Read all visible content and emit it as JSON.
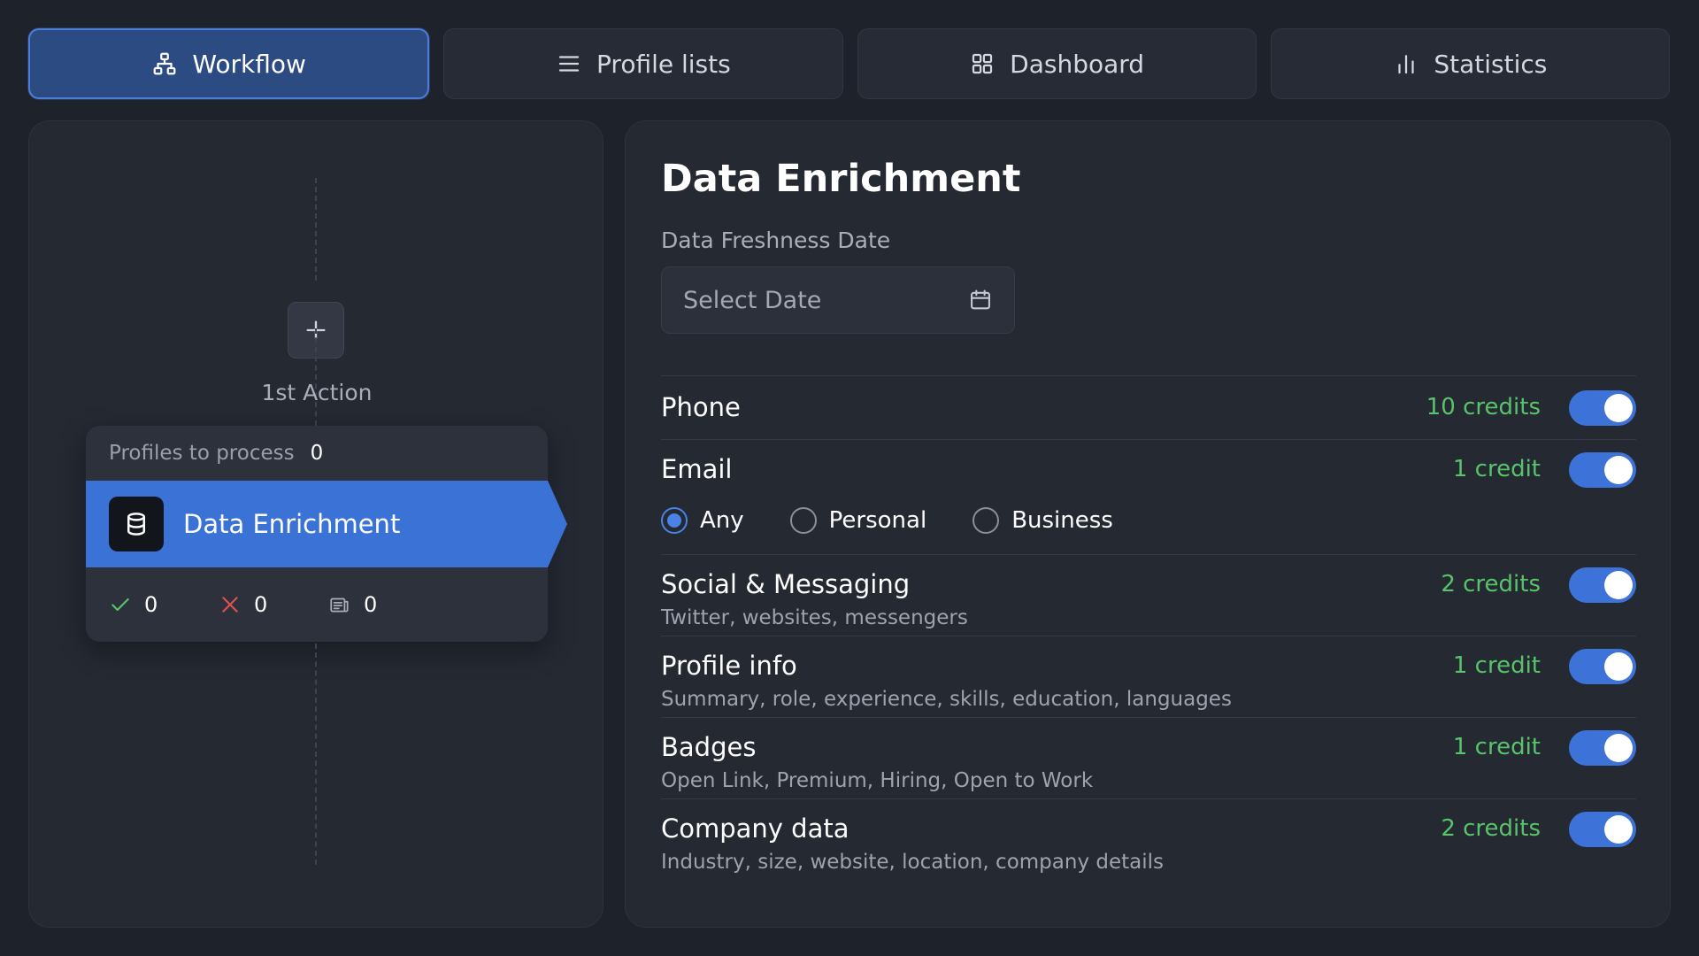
{
  "tabs": [
    {
      "label": "Workflow",
      "icon": "workflow-icon",
      "active": true
    },
    {
      "label": "Profile lists",
      "icon": "list-icon",
      "active": false
    },
    {
      "label": "Dashboard",
      "icon": "grid-icon",
      "active": false
    },
    {
      "label": "Statistics",
      "icon": "bar-chart-icon",
      "active": false
    }
  ],
  "workflow": {
    "first_action_label": "1st Action",
    "node": {
      "profiles_label": "Profiles to process",
      "profiles_count": "0",
      "title": "Data Enrichment",
      "success_count": "0",
      "failed_count": "0",
      "pending_count": "0"
    }
  },
  "enrichment": {
    "title": "Data Enrichment",
    "freshness_label": "Data Freshness Date",
    "date_placeholder": "Select Date",
    "email_options": [
      {
        "label": "Any",
        "selected": true
      },
      {
        "label": "Personal",
        "selected": false
      },
      {
        "label": "Business",
        "selected": false
      }
    ],
    "items": [
      {
        "name": "Phone",
        "description": "",
        "credits": "10 credits",
        "enabled": true
      },
      {
        "name": "Email",
        "description": "",
        "credits": "1 credit",
        "enabled": true
      },
      {
        "name": "Social & Messaging",
        "description": "Twitter, websites, messengers",
        "credits": "2 credits",
        "enabled": true
      },
      {
        "name": "Profile info",
        "description": "Summary, role, experience, skills, education, languages",
        "credits": "1 credit",
        "enabled": true
      },
      {
        "name": "Badges",
        "description": "Open Link, Premium, Hiring, Open to Work",
        "credits": "1 credit",
        "enabled": true
      },
      {
        "name": "Company data",
        "description": "Industry, size, website, location, company details",
        "credits": "2 credits",
        "enabled": true
      }
    ]
  },
  "colors": {
    "background": "#1d222b",
    "panel": "#242932",
    "accent": "#3b72d6",
    "credits_green": "#58c36a",
    "failed_red": "#e0524f",
    "success_green": "#58c36a"
  }
}
